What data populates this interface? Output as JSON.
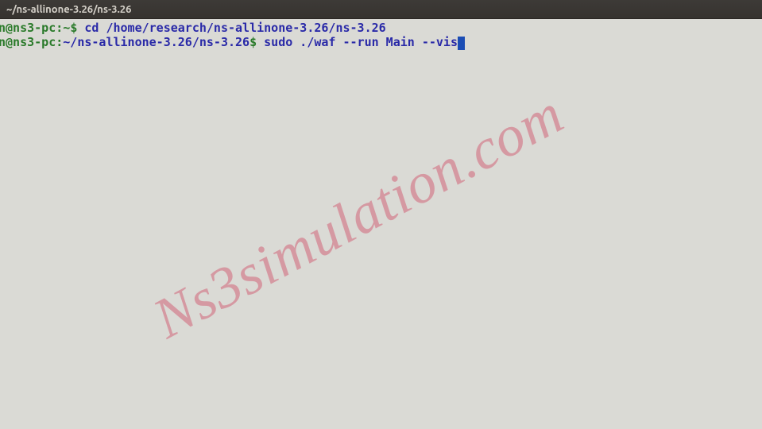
{
  "window": {
    "title": "~/ns-allinone-3.26/ns-3.26"
  },
  "lines": [
    {
      "user_host": "n@ns3-pc",
      "sep": ":",
      "tilde": "~",
      "dollar": "$ ",
      "cmd": "cd /home/research/ns-allinone-3.26/ns-3.26"
    },
    {
      "user_host": "n@ns3-pc",
      "sep": ":",
      "path": "~/ns-allinone-3.26/ns-3.26",
      "dollar": "$ ",
      "cmd": "sudo ./waf --run Main --vis"
    }
  ],
  "watermark": "Ns3simulation.com"
}
